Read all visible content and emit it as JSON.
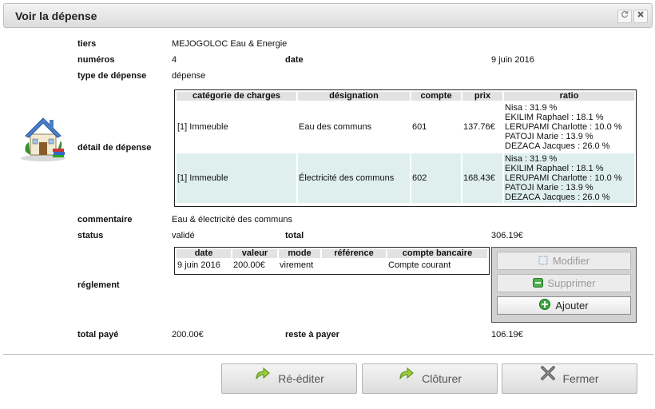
{
  "dialog": {
    "title": "Voir la dépense"
  },
  "fields": {
    "tiers_label": "tiers",
    "tiers_value": "MEJOGOLOC Eau & Energie",
    "numeros_label": "numéros",
    "numeros_value": "4",
    "date_label": "date",
    "date_value": "9 juin 2016",
    "type_label": "type de dépense",
    "type_value": "dépense",
    "detail_label": "détail de dépense",
    "commentaire_label": "commentaire",
    "commentaire_value": "Eau & électricité des communs",
    "status_label": "status",
    "status_value": "validé",
    "total_label": "total",
    "total_value": "306.19€",
    "reglement_label": "réglement",
    "total_paye_label": "total payé",
    "total_paye_value": "200.00€",
    "reste_label": "reste à payer",
    "reste_value": "106.19€"
  },
  "detail_table": {
    "headers": [
      "catégorie de charges",
      "désignation",
      "compte",
      "prix",
      "ratio"
    ],
    "rows": [
      {
        "categorie": "[1] Immeuble",
        "designation": "Eau des communs",
        "compte": "601",
        "prix": "137.76€",
        "ratio": [
          "Nisa : 31.9 %",
          "EKILIM Raphael : 18.1 %",
          "LERUPAMI Charlotte : 10.0 %",
          "PATOJI Marie : 13.9 %",
          "DEZACA Jacques : 26.0 %"
        ]
      },
      {
        "categorie": "[1] Immeuble",
        "designation": "Électricité des communs",
        "compte": "602",
        "prix": "168.43€",
        "ratio": [
          "Nisa : 31.9 %",
          "EKILIM Raphael : 18.1 %",
          "LERUPAMI Charlotte : 10.0 %",
          "PATOJI Marie : 13.9 %",
          "DEZACA Jacques : 26.0 %"
        ]
      }
    ]
  },
  "payment_table": {
    "headers": [
      "date",
      "valeur",
      "mode",
      "référence",
      "compte bancaire"
    ],
    "rows": [
      {
        "date": "9 juin 2016",
        "valeur": "200.00€",
        "mode": "virement",
        "reference": "",
        "compte": "Compte courant"
      }
    ]
  },
  "side_buttons": {
    "modifier": "Modifier",
    "supprimer": "Supprimer",
    "ajouter": "Ajouter"
  },
  "footer_buttons": {
    "reediter": "Ré-éditer",
    "cloturer": "Clôturer",
    "fermer": "Fermer"
  },
  "icons": {
    "header_refresh": "refresh-icon",
    "header_close": "close-icon",
    "main": "house-icon",
    "modifier": "edit-icon",
    "supprimer": "minus-icon",
    "ajouter": "plus-icon",
    "reediter": "arrow-up-right-icon",
    "cloturer": "arrow-up-right-icon",
    "fermer": "x-icon"
  },
  "colors": {
    "alt_row": "#deefee",
    "header_cell": "#e2e2e2",
    "accent_green": "#2e9e3a"
  }
}
